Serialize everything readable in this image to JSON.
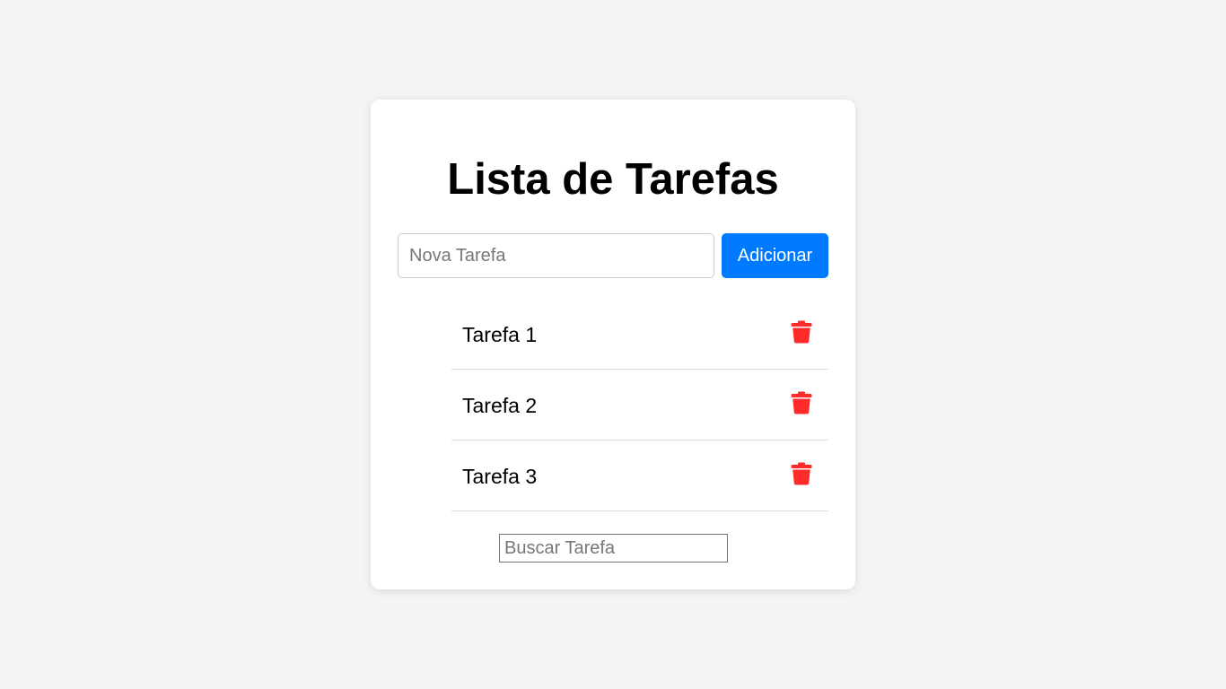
{
  "title": "Lista de Tarefas",
  "new_task": {
    "value": "",
    "placeholder": "Nova Tarefa"
  },
  "add_button_label": "Adicionar",
  "tasks": [
    {
      "label": "Tarefa 1"
    },
    {
      "label": "Tarefa 2"
    },
    {
      "label": "Tarefa 3"
    }
  ],
  "search": {
    "value": "",
    "placeholder": "Buscar Tarefa"
  },
  "icons": {
    "delete": "trash-icon"
  },
  "colors": {
    "accent": "#007bff",
    "delete": "#ff2a2a",
    "background": "#f4f4f4",
    "card": "#ffffff"
  }
}
